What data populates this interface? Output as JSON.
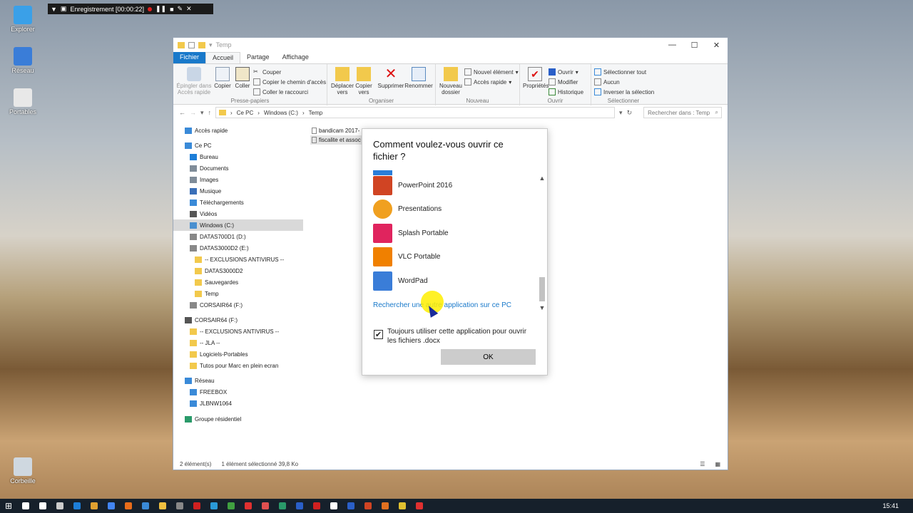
{
  "desktop": {
    "icons": [
      {
        "label": "Explorer",
        "color": "#3aa0e8"
      },
      {
        "label": "Réseau",
        "color": "#3a7dd8"
      },
      {
        "label": "Portables",
        "color": "#e8e8e8"
      },
      {
        "label": "Corbeille",
        "color": "#cfd8e0"
      }
    ]
  },
  "recorder": {
    "text": "Enregistrement [00:00:22]"
  },
  "window": {
    "title": "Temp",
    "controls": [
      "—",
      "☐",
      "✕"
    ],
    "tabs": {
      "file": "Fichier",
      "home": "Accueil",
      "share": "Partage",
      "view": "Affichage"
    },
    "ribbon": {
      "clipboard": {
        "label": "Presse-papiers",
        "pin": "Épingler dans\nAccès rapide",
        "copy": "Copier",
        "paste": "Coller",
        "cut": "Couper",
        "copy_path": "Copier le chemin d'accès",
        "paste_shortcut": "Coller le raccourci"
      },
      "organize": {
        "label": "Organiser",
        "move": "Déplacer\nvers",
        "copy_to": "Copier\nvers",
        "delete": "Supprimer",
        "rename": "Renommer"
      },
      "new": {
        "label": "Nouveau",
        "new_folder": "Nouveau\ndossier",
        "new_item": "Nouvel élément",
        "easy_access": "Accès rapide"
      },
      "open": {
        "label": "Ouvrir",
        "properties": "Propriétés",
        "open": "Ouvrir",
        "edit": "Modifier",
        "history": "Historique"
      },
      "select": {
        "label": "Sélectionner",
        "select_all": "Sélectionner tout",
        "select_none": "Aucun",
        "invert": "Inverser la sélection"
      }
    },
    "address": {
      "path": [
        "Ce PC",
        "Windows (C:)",
        "Temp"
      ],
      "search_placeholder": "Rechercher dans : Temp"
    },
    "nav": [
      {
        "label": "Accès rapide",
        "indent": 0,
        "icon": "#3a8ad8"
      },
      {
        "label": "Ce PC",
        "indent": 0,
        "icon": "#3a8ad8"
      },
      {
        "label": "Bureau",
        "indent": 1,
        "icon": "#1d7ed8"
      },
      {
        "label": "Documents",
        "indent": 1,
        "icon": "#7f8c99"
      },
      {
        "label": "Images",
        "indent": 1,
        "icon": "#7f8c99"
      },
      {
        "label": "Musique",
        "indent": 1,
        "icon": "#3a6fb8"
      },
      {
        "label": "Téléchargements",
        "indent": 1,
        "icon": "#3a8ad8"
      },
      {
        "label": "Vidéos",
        "indent": 1,
        "icon": "#555555"
      },
      {
        "label": "Windows (C:)",
        "indent": 1,
        "icon": "#4a90d0",
        "selected": true
      },
      {
        "label": "DATAS700D1 (D:)",
        "indent": 1,
        "icon": "#888888"
      },
      {
        "label": "DATAS3000D2 (E:)",
        "indent": 1,
        "icon": "#888888"
      },
      {
        "label": "--  EXCLUSIONS ANTIVIRUS  --",
        "indent": 2,
        "icon": "#f2c94c"
      },
      {
        "label": "DATAS3000D2",
        "indent": 2,
        "icon": "#f2c94c"
      },
      {
        "label": "Sauvegardes",
        "indent": 2,
        "icon": "#f2c94c"
      },
      {
        "label": "Temp",
        "indent": 2,
        "icon": "#f2c94c"
      },
      {
        "label": "CORSAIR64 (F:)",
        "indent": 1,
        "icon": "#888888"
      },
      {
        "label": "CORSAIR64 (F:)",
        "indent": 0,
        "icon": "#555555"
      },
      {
        "label": "--  EXCLUSIONS ANTIVIRUS  --",
        "indent": 1,
        "icon": "#f2c94c"
      },
      {
        "label": "--  JLA  --",
        "indent": 1,
        "icon": "#f2c94c"
      },
      {
        "label": "Logiciels-Portables",
        "indent": 1,
        "icon": "#f2c94c"
      },
      {
        "label": "Tutos pour Marc en plein ecran",
        "indent": 1,
        "icon": "#f2c94c"
      },
      {
        "label": "Réseau",
        "indent": 0,
        "icon": "#3a8ad8"
      },
      {
        "label": "FREEBOX",
        "indent": 1,
        "icon": "#3a8ad8"
      },
      {
        "label": "JLBNW1064",
        "indent": 1,
        "icon": "#3a8ad8"
      },
      {
        "label": "Groupe résidentiel",
        "indent": 0,
        "icon": "#2a9a6a"
      }
    ],
    "files": [
      {
        "name": "bandicam 2017-",
        "selected": false
      },
      {
        "name": "fiscalite et assoc",
        "selected": true
      }
    ],
    "status": {
      "count": "2 élément(s)",
      "selection": "1 élément sélectionné  39,8 Ko"
    }
  },
  "dialog": {
    "title": "Comment voulez-vous ouvrir ce fichier ?",
    "apps": [
      {
        "name": "PowerPoint 2016",
        "color": "#d04423"
      },
      {
        "name": "Presentations",
        "color": "#f0a020"
      },
      {
        "name": "Splash Portable",
        "color": "#e0245e"
      },
      {
        "name": "VLC Portable",
        "color": "#f08000"
      },
      {
        "name": "WordPad",
        "color": "#3a7dd8"
      }
    ],
    "search_link": "Rechercher une autre application sur ce PC",
    "always_use": "Toujours utiliser cette application pour ouvrir les fichiers .docx",
    "always_checked": true,
    "ok": "OK"
  },
  "taskbar": {
    "icon_colors": [
      "#ffffff",
      "#ffffff",
      "#cccccc",
      "#1d7ed8",
      "#e0a030",
      "#4285f4",
      "#e86c1a",
      "#3a8ad8",
      "#f0c040",
      "#888888",
      "#d02020",
      "#2a9ad8",
      "#40a040",
      "#e03030",
      "#e05050",
      "#2a9a6a",
      "#2a5fc8",
      "#d02020",
      "#ffffff",
      "#2a5fc8",
      "#d04423",
      "#e07020",
      "#e0c030",
      "#e03030"
    ],
    "clock": "15:41"
  }
}
